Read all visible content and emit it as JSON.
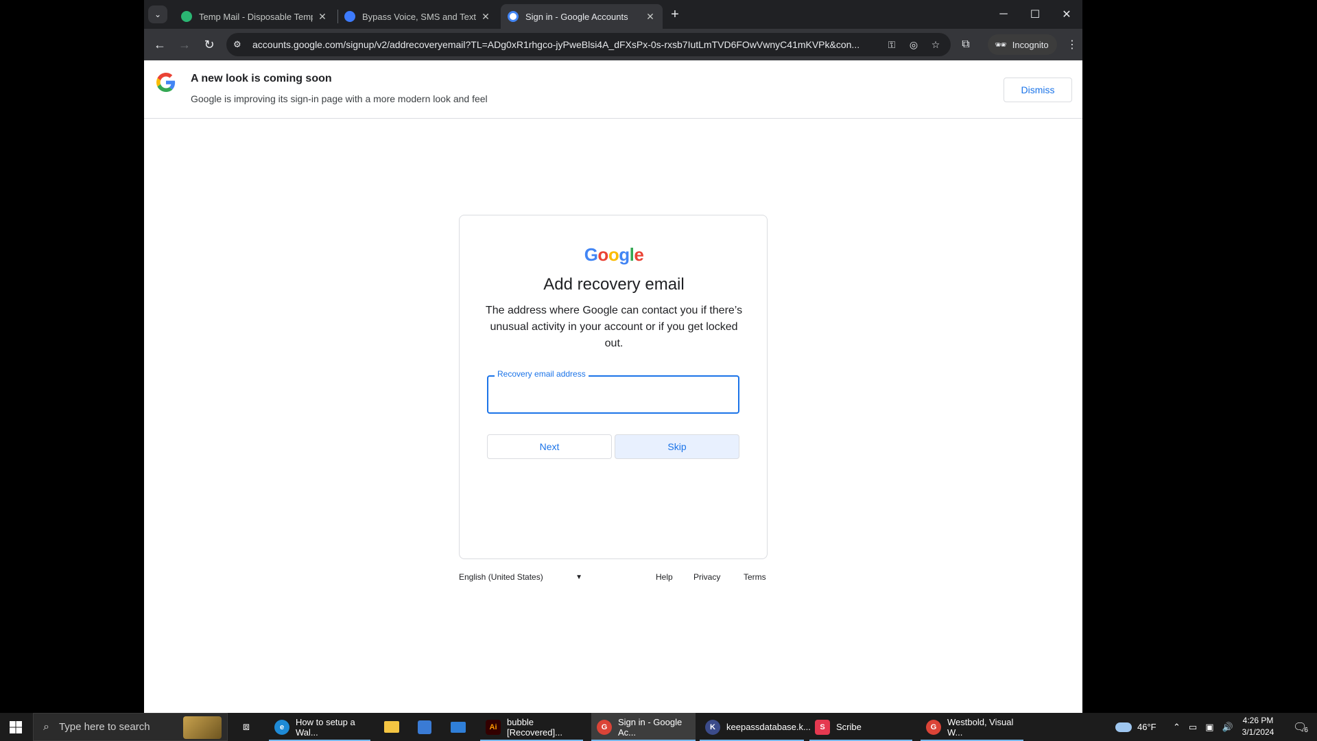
{
  "browser": {
    "tabs": [
      {
        "title": "Temp Mail - Disposable Tempor",
        "favicon_color": "#2bb673"
      },
      {
        "title": "Bypass Voice, SMS and Text Ver",
        "favicon_color": "#3d7bfd"
      },
      {
        "title": "Sign in - Google Accounts",
        "favicon_color": "#4285f4"
      }
    ],
    "close_glyph": "✕",
    "new_tab_glyph": "+",
    "url": "accounts.google.com/signup/v2/addrecoveryemail?TL=ADg0xR1rhgco-jyPweBlsi4A_dFXsPx-0s-rxsb7IutLmTVD6FOwVwnyC41mKVPk&con...",
    "incognito_label": "Incognito"
  },
  "banner": {
    "title": "A new look is coming soon",
    "text": "Google is improving its sign-in page with a more modern look and feel",
    "dismiss_label": "Dismiss"
  },
  "card": {
    "wordmark": [
      "G",
      "o",
      "o",
      "g",
      "l",
      "e"
    ],
    "heading": "Add recovery email",
    "description": "The address where Google can contact you if there’s unusual activity in your account or if you get locked out.",
    "field_label": "Recovery email address",
    "field_value": "",
    "next_label": "Next",
    "skip_label": "Skip"
  },
  "footer": {
    "language": "English (United States)",
    "links": [
      "Help",
      "Privacy",
      "Terms"
    ]
  },
  "taskbar": {
    "search_placeholder": "Type here to search",
    "apps": [
      {
        "label": "How to setup a Wal...",
        "color": "#1e8ad6",
        "glyph": "e"
      },
      {
        "label": "bubble [Recovered]...",
        "color": "#330000",
        "glyph": "Ai"
      },
      {
        "label": "Sign in - Google Ac...",
        "color": "#db4437",
        "glyph": "G"
      },
      {
        "label": "keepassdatabase.k...",
        "color": "#3b4b8a",
        "glyph": "K"
      },
      {
        "label": "Scribe",
        "color": "#e53950",
        "glyph": "S"
      },
      {
        "label": "Westbold, Visual W...",
        "color": "#db4437",
        "glyph": "G"
      }
    ],
    "weather": "46°F",
    "time": "4:26 PM",
    "date": "3/1/2024",
    "notification_count": "6"
  },
  "colors": {
    "google_blue": "#4285f4",
    "google_red": "#ea4335",
    "google_yellow": "#fbbc05",
    "google_green": "#34a853",
    "accent": "#1a73e8"
  }
}
